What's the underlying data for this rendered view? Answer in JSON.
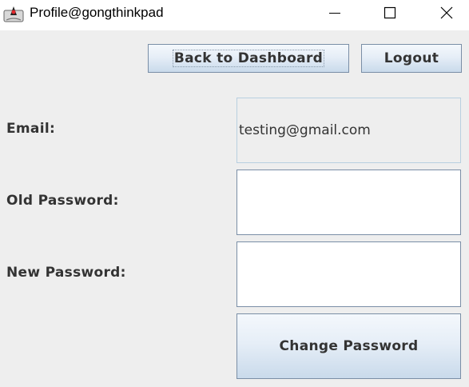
{
  "window": {
    "title": "Profile@gongthinkpad",
    "icons": {
      "app": "java-duke-icon",
      "minimize": "minimize-icon",
      "maximize": "maximize-icon",
      "close": "close-icon"
    }
  },
  "toolbar": {
    "back_label": "Back to Dashboard",
    "logout_label": "Logout"
  },
  "form": {
    "email_label": "Email:",
    "email_value": "testing@gmail.com",
    "old_password_label": "Old Password:",
    "old_password_value": "",
    "new_password_label": "New Password:",
    "new_password_value": "",
    "change_password_label": "Change Password"
  },
  "colors": {
    "background": "#eeeeee",
    "button_border": "#7a8ea6",
    "text": "#333333"
  }
}
